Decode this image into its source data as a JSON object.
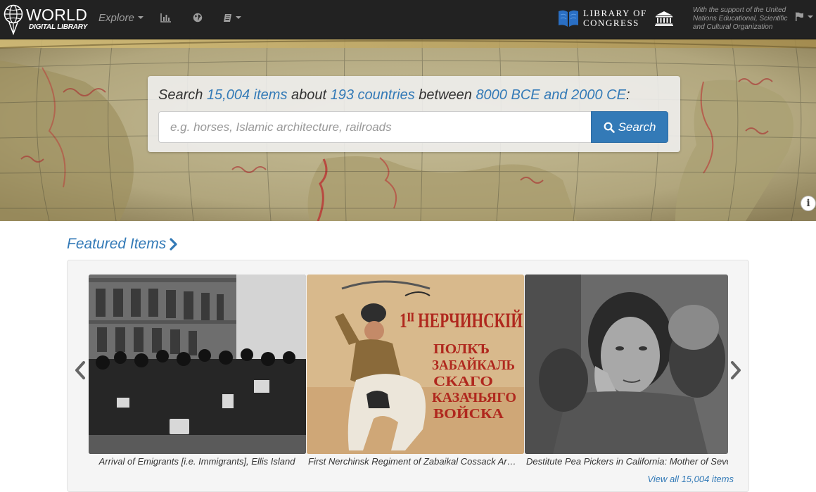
{
  "navbar": {
    "brand_title": "WORLD",
    "brand_subtitle": "DIGITAL LIBRARY",
    "explore_label": "Explore",
    "loc_line1": "LIBRARY OF",
    "loc_line2": "CONGRESS",
    "unesco_text": "With the support of the United Nations Educational, Scientific and Cultural Organization"
  },
  "search": {
    "prefix": "Search ",
    "items_link": "15,004 items",
    "about": " about ",
    "countries_link": "193 countries",
    "between": " between ",
    "dates_link": "8000 BCE and 2000 CE",
    "suffix": ":",
    "placeholder": "e.g. horses, Islamic architecture, railroads",
    "button_label": "Search"
  },
  "hero": {
    "info_label": "i"
  },
  "featured": {
    "heading": "Featured Items",
    "items": [
      {
        "caption": "Arrival of Emigrants [i.e. Immigrants], Ellis Island"
      },
      {
        "caption": "First Nerchinsk Regiment of Zabaikal Cossack Army"
      },
      {
        "caption": "Destitute Pea Pickers in California: Mother of Seven Children"
      }
    ],
    "poster_lines": [
      "1ᴵᴵ НЕРЧИНСКІЙ",
      "ПОЛКЪ",
      "ЗАБАЙКАЛЬ",
      "СКАГО",
      "КАЗАЧЬЯГО",
      "ВОЙСКА"
    ],
    "view_all": "View all 15,004 items"
  },
  "colors": {
    "navbar_bg": "#222222",
    "link_blue": "#337ab7",
    "button_blue": "#337ab7"
  }
}
